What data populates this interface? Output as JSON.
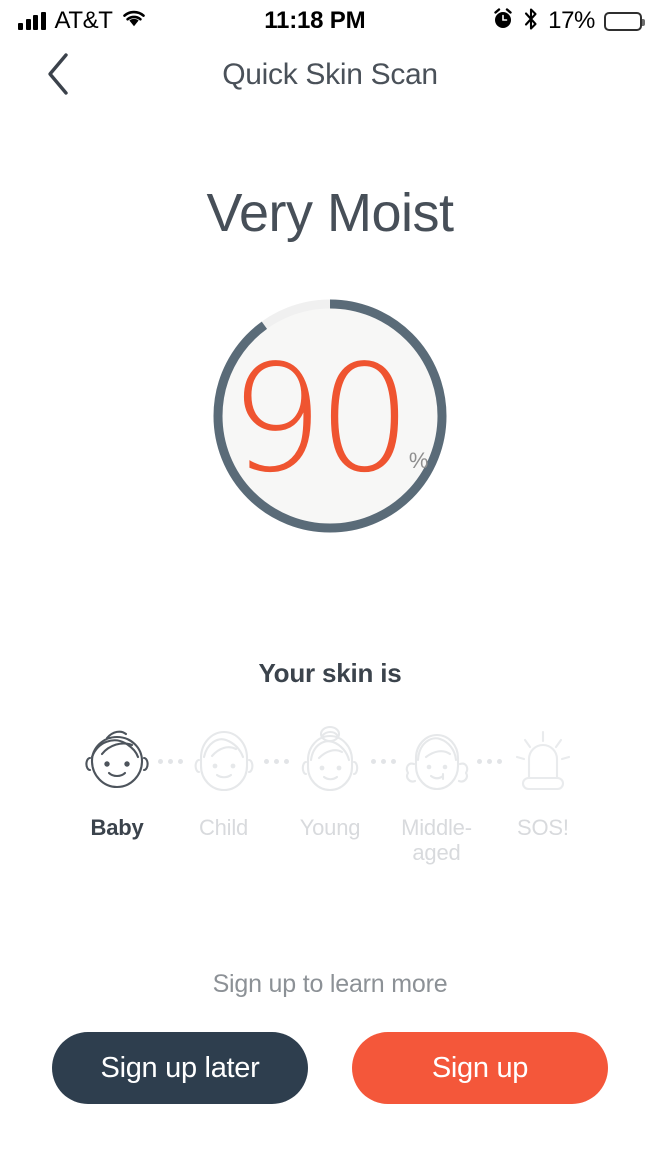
{
  "status_bar": {
    "carrier": "AT&T",
    "time": "11:18 PM",
    "battery_percent": "17%",
    "battery_level": 17,
    "icons": {
      "signal": "signal-bars-icon",
      "wifi": "wifi-icon",
      "alarm": "alarm-clock-icon",
      "bluetooth": "bluetooth-icon",
      "battery": "battery-low-icon"
    }
  },
  "nav": {
    "back_icon": "chevron-left-icon",
    "title": "Quick Skin Scan"
  },
  "result": {
    "headline": "Very Moist",
    "gauge": {
      "value": "90",
      "unit": "%",
      "percent": 90,
      "track_color": "#f0f0f0",
      "progress_color": "#5a6b78",
      "value_color": "#ef5430",
      "fill_color": "#f7f7f6"
    }
  },
  "skin_stages": {
    "label": "Your skin is",
    "active_index": 0,
    "items": [
      {
        "label": "Baby",
        "icon": "baby-face-icon",
        "active": true
      },
      {
        "label": "Child",
        "icon": "child-face-icon",
        "active": false
      },
      {
        "label": "Young",
        "icon": "young-face-icon",
        "active": false
      },
      {
        "label": "Middle-aged",
        "icon": "middle-aged-face-icon",
        "active": false
      },
      {
        "label": "SOS!",
        "icon": "siren-alarm-icon",
        "active": false
      }
    ]
  },
  "footer": {
    "learn_more": "Sign up to learn more",
    "sign_up_later": "Sign up later",
    "sign_up": "Sign up",
    "secondary_color": "#2e3e4e",
    "primary_color": "#f4573a"
  }
}
